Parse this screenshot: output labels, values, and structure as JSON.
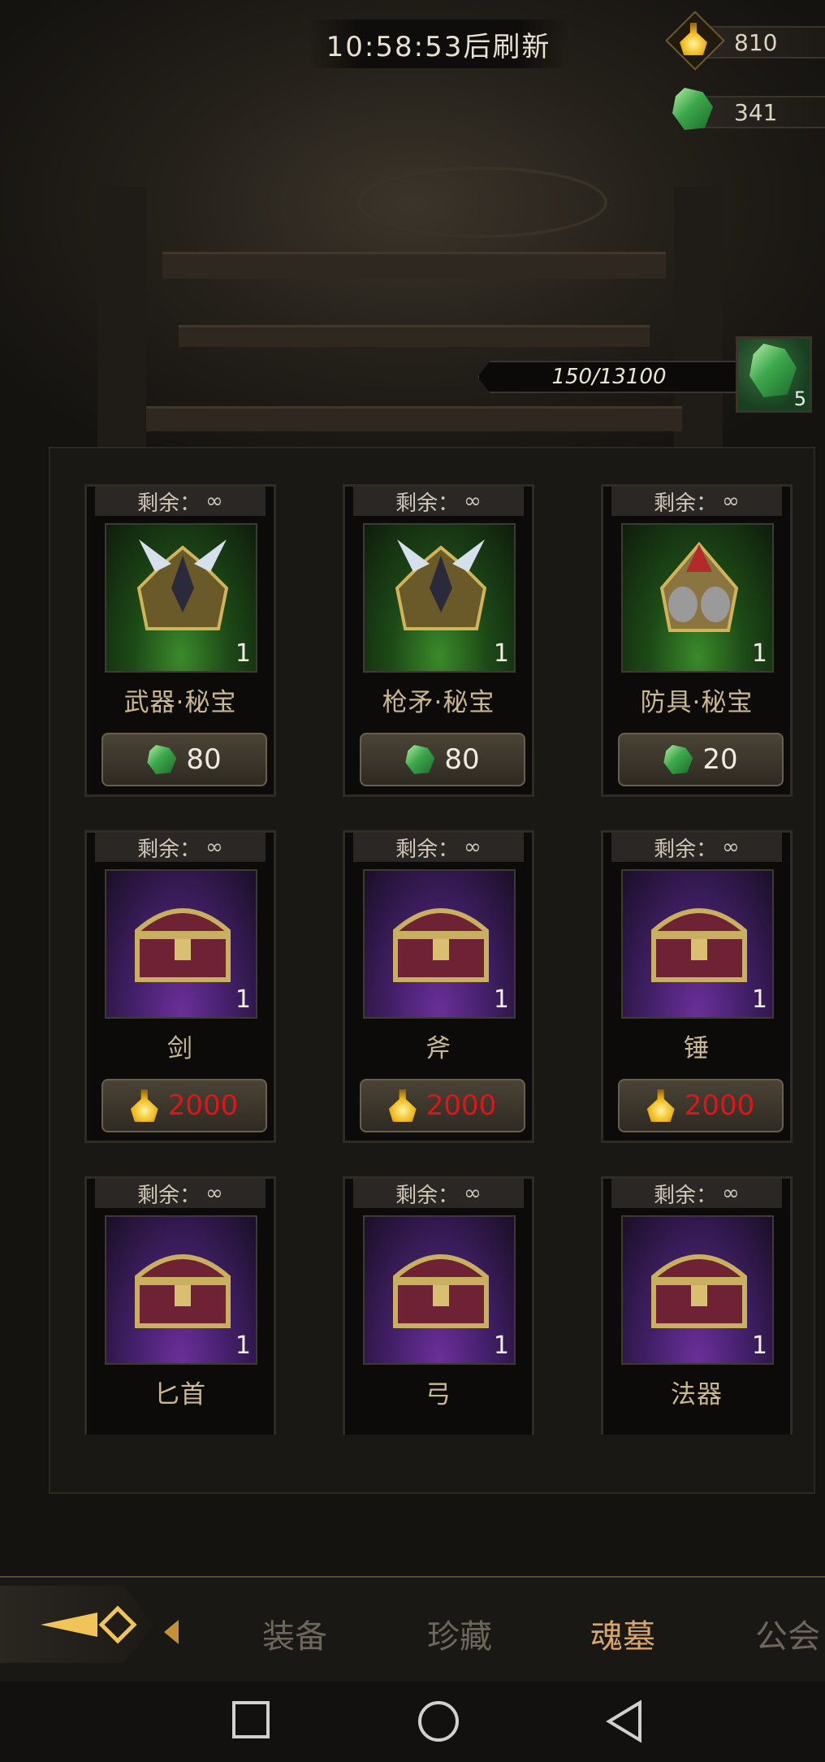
{
  "header": {
    "refresh_timer": "10:58:53后刷新"
  },
  "currencies": [
    {
      "icon": "lantern-flask-icon",
      "value": "810"
    },
    {
      "icon": "green-crystal-icon",
      "value": "341"
    }
  ],
  "progress": {
    "text": "150/13100",
    "reward_icon": "green-crystal-icon",
    "reward_count": "5"
  },
  "shop": {
    "remain_label": "剩余：",
    "remain_value": "∞",
    "items": [
      {
        "name": "武器·秘宝",
        "count": "1",
        "price": "80",
        "currency": "green-crystal-icon",
        "rarity": "green"
      },
      {
        "name": "枪矛·秘宝",
        "count": "1",
        "price": "80",
        "currency": "green-crystal-icon",
        "rarity": "green"
      },
      {
        "name": "防具·秘宝",
        "count": "1",
        "price": "20",
        "currency": "green-crystal-icon",
        "rarity": "green"
      },
      {
        "name": "剑",
        "count": "1",
        "price": "2000",
        "currency": "lantern-flask-icon",
        "rarity": "purple"
      },
      {
        "name": "斧",
        "count": "1",
        "price": "2000",
        "currency": "lantern-flask-icon",
        "rarity": "purple"
      },
      {
        "name": "锤",
        "count": "1",
        "price": "2000",
        "currency": "lantern-flask-icon",
        "rarity": "purple"
      },
      {
        "name": "匕首",
        "count": "1",
        "price": "",
        "currency": "",
        "rarity": "purple"
      },
      {
        "name": "弓",
        "count": "1",
        "price": "",
        "currency": "",
        "rarity": "purple"
      },
      {
        "name": "法器",
        "count": "1",
        "price": "",
        "currency": "",
        "rarity": "purple"
      }
    ]
  },
  "nav": {
    "tabs": [
      "装备",
      "珍藏",
      "魂墓",
      "公会"
    ],
    "active": "魂墓"
  },
  "colors": {
    "price_insufficient": "#e0151a",
    "active_tab": "#d8a56a",
    "inactive_tab": "#6e665a"
  }
}
